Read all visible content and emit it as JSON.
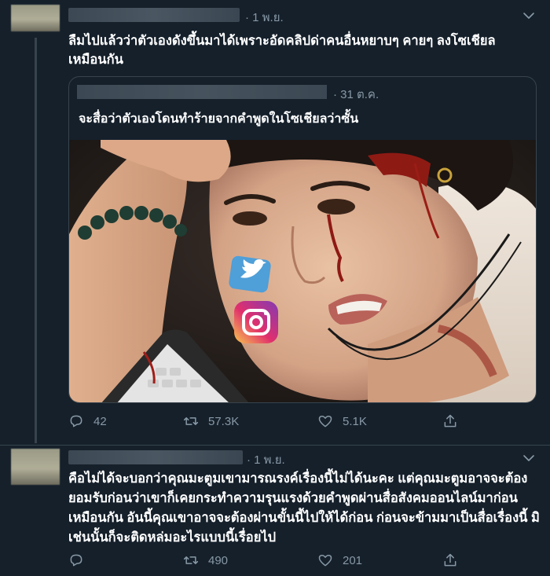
{
  "tweet1": {
    "time": "· 1 พ.ย.",
    "text_line1": "ลืมไปแล้วว่าตัวเองดังขึ้นมาได้เพราะอัดคลิปด่าคนอื่นหยาบๆ คายๆ ลงโซเชียล",
    "text_line2": "เหมือนกัน",
    "quote": {
      "time": "· 31 ต.ค.",
      "text": "จะสื่อว่าตัวเองโดนทำร้ายจากคำพูดในโซเชียลว่าซั้น"
    },
    "actions": {
      "reply_count": "42",
      "retweet_count": "57.3K",
      "like_count": "5.1K"
    }
  },
  "tweet2": {
    "time": "· 1 พ.ย.",
    "text_line1": "คือไม่ได้จะบอกว่าคุณมะตูมเขามารณรงค์เรื่องนี้ไม่ได้นะคะ แต่คุณมะตูมอาจจะต้อง",
    "text_line2": "ยอมรับก่อนว่าเขาก็เคยกระทำความรุนแรงด้วยคำพูดผ่านสื่อสังคมออนไลน์มาก่อน",
    "text_line3": "เหมือนกัน อันนี้คุณเขาอาจจะต้องผ่านขั้นนี้ไปให้ได้ก่อน ก่อนจะข้ามมาเป็นสื่อเรื่องนี้ มิ",
    "text_line4": "เช่นนั้นก็จะติดหล่มอะไรแบบนี้เรื่อยไป",
    "actions": {
      "reply_count": "",
      "retweet_count": "490",
      "like_count": "201"
    }
  },
  "colors": {
    "background": "#15202b",
    "border": "#38444d",
    "secondary_text": "#8899a6",
    "primary_text": "#ffffff"
  },
  "icons": [
    "chevron-down-icon",
    "reply-icon",
    "retweet-icon",
    "like-icon",
    "share-icon",
    "twitter-logo-icon",
    "instagram-logo-icon"
  ]
}
